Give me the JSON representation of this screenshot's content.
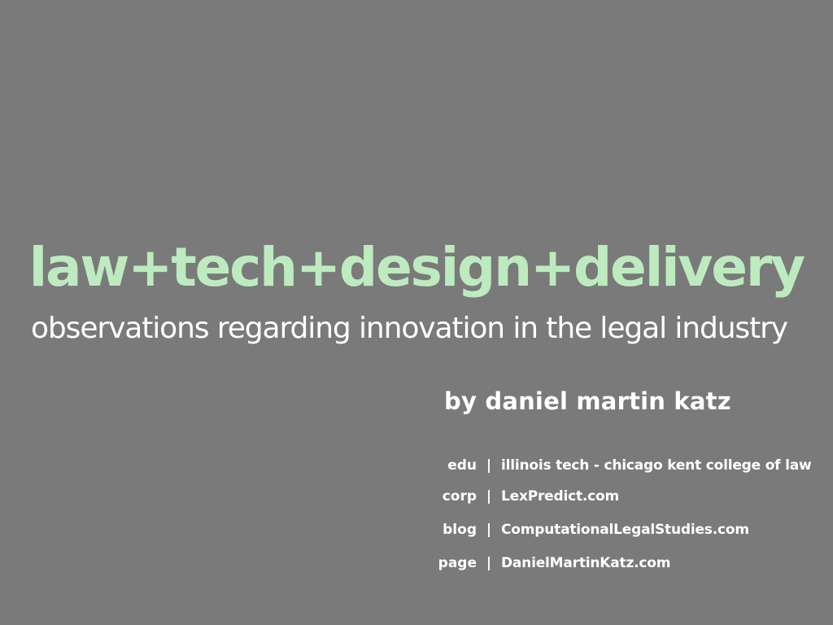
{
  "slide": {
    "title": "law+tech+design+delivery",
    "subtitle": "observations regarding innovation in the legal industry",
    "byline": "by daniel martin katz",
    "links": [
      {
        "key": "edu",
        "separator": "|",
        "value": "illinois tech - chicago kent college of law"
      },
      {
        "key": "corp",
        "separator": "|",
        "value": "LexPredict.com"
      },
      {
        "key": "blog",
        "separator": "|",
        "value": "ComputationalLegalStudies.com"
      },
      {
        "key": "page",
        "separator": "|",
        "value": "DanielMartinKatz.com"
      }
    ]
  },
  "colors": {
    "background": "#7a7a7a",
    "title": "#bdebbf",
    "text": "#ffffff"
  }
}
